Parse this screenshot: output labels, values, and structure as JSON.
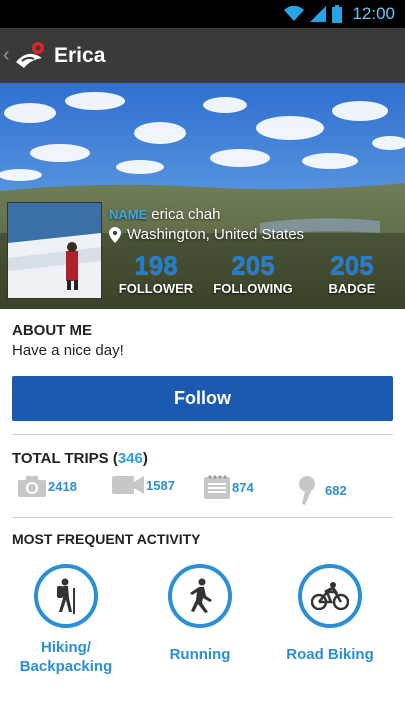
{
  "status_bar": {
    "time": "12:00"
  },
  "app_bar": {
    "title": "Erica",
    "back_icon": "chevron-left-icon",
    "logo_icon": "app-logo-icon"
  },
  "profile": {
    "name_label": "NAME",
    "name": "erica chah",
    "location": "Washington, United States",
    "stats": [
      {
        "value": "198",
        "label": "FOLLOWER"
      },
      {
        "value": "205",
        "label": "FOLLOWING"
      },
      {
        "value": "205",
        "label": "BADGE"
      }
    ]
  },
  "about": {
    "title": "ABOUT ME",
    "text": "Have a nice day!"
  },
  "follow_button": {
    "label": "Follow"
  },
  "trips": {
    "title_prefix": "TOTAL TRIPS (",
    "count": "346",
    "title_suffix": ")",
    "items": [
      {
        "icon": "camera-icon",
        "value": "2418"
      },
      {
        "icon": "video-camera-icon",
        "value": "1587"
      },
      {
        "icon": "notepad-icon",
        "value": "874"
      },
      {
        "icon": "microphone-icon",
        "value": "682"
      }
    ]
  },
  "activity": {
    "title": "MOST FREQUENT ACTIVITY",
    "items": [
      {
        "icon": "hiking-icon",
        "label": "Hiking/ Backpacking"
      },
      {
        "icon": "running-icon",
        "label": "Running"
      },
      {
        "icon": "road-biking-icon",
        "label": "Road Biking"
      }
    ]
  },
  "colors": {
    "accent": "#2a8fd6",
    "button": "#1a5ab0",
    "app_bar": "#3a3a3a",
    "status_bar": "#000000"
  }
}
